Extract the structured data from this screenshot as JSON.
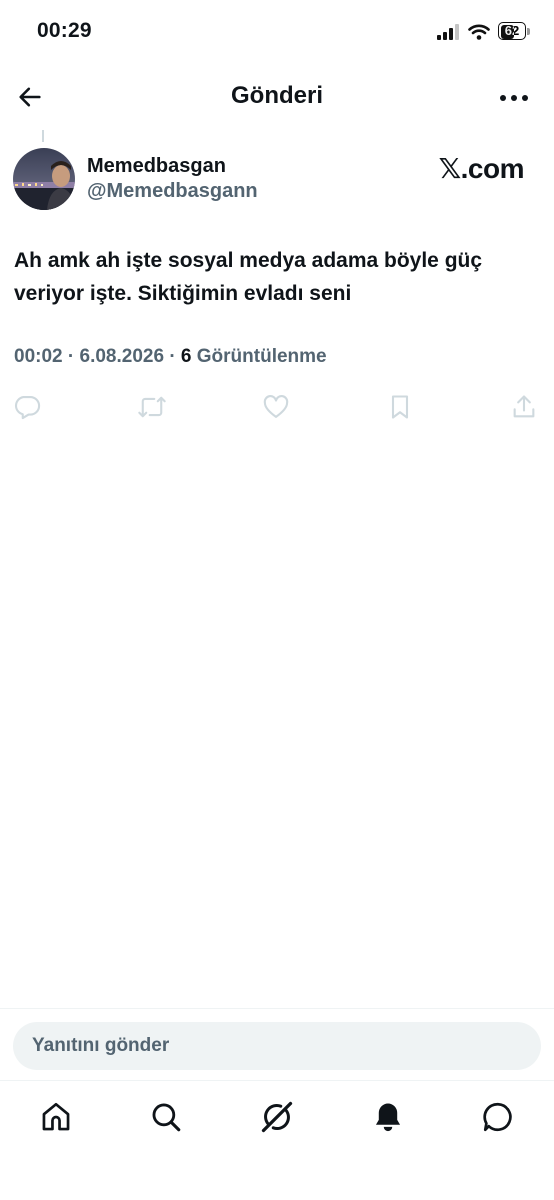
{
  "status_bar": {
    "time": "00:29",
    "battery": "62",
    "battery_level_percent": 62
  },
  "header": {
    "title": "Gönderi"
  },
  "post": {
    "display_name": "Memedbasgan",
    "handle": "@Memedbasgann",
    "watermark": "𝕏.com",
    "text": "Ah amk ah işte sosyal medya adama böyle güç veriyor işte. Siktiğimin evladı seni",
    "time": "00:02",
    "date": "6.08.2026",
    "views_count": "6",
    "views_label": "Görüntülenme"
  },
  "reply": {
    "placeholder": "Yanıtını gönder"
  },
  "icons": {
    "back": "back-arrow-icon",
    "more": "more-icon",
    "reply": "reply-icon",
    "repost": "repost-icon",
    "like": "heart-icon",
    "bookmark": "bookmark-icon",
    "share": "share-icon",
    "tabs": [
      "home-icon",
      "search-icon",
      "grok-icon",
      "notifications-icon",
      "messages-icon"
    ]
  },
  "colors": {
    "text": "#0f1419",
    "secondary": "#536471",
    "action_icon": "#cfd9de",
    "input_bg": "#eff3f4"
  }
}
